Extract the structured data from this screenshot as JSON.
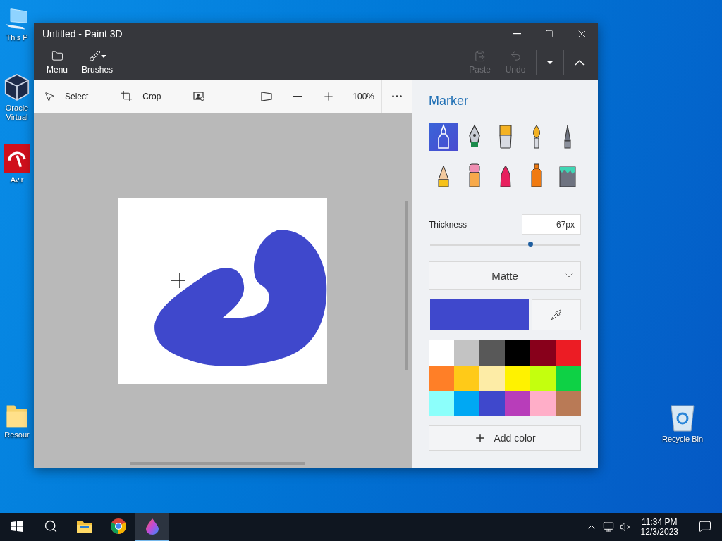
{
  "desktop_icons": [
    {
      "kind": "computer",
      "label": "This P"
    },
    {
      "kind": "cube",
      "label": "Oracle\nVirtual"
    },
    {
      "kind": "umbrella",
      "label": "Avir"
    },
    {
      "kind": "folder",
      "label": "Resour"
    },
    {
      "kind": "bin",
      "label": "Recycle Bin"
    }
  ],
  "window": {
    "title": "Untitled - Paint 3D",
    "commands": [
      {
        "kind": "menu",
        "label": "Menu"
      },
      {
        "kind": "brushes",
        "label": "Brushes"
      }
    ],
    "right_commands": [
      {
        "kind": "paste",
        "label": "Paste",
        "disabled": true
      },
      {
        "kind": "undo",
        "label": "Undo",
        "disabled": true
      }
    ],
    "toolbar": [
      {
        "kind": "select",
        "label": "Select"
      },
      {
        "kind": "crop",
        "label": "Crop"
      },
      {
        "kind": "magic"
      }
    ],
    "zoom": "100%",
    "panel": {
      "title": "Marker",
      "tools": [
        {
          "kind": "marker",
          "selected": true
        },
        {
          "kind": "pen",
          "selected": false
        },
        {
          "kind": "oil",
          "selected": false
        },
        {
          "kind": "watercolor",
          "selected": false
        },
        {
          "kind": "pixel",
          "selected": false
        },
        {
          "kind": "pencil",
          "selected": false
        },
        {
          "kind": "eraser",
          "selected": false
        },
        {
          "kind": "crayon",
          "selected": false
        },
        {
          "kind": "spray",
          "selected": false
        },
        {
          "kind": "fill",
          "selected": false
        }
      ],
      "thickness": {
        "label": "Thickness",
        "value": "67",
        "unit": "px",
        "level": 0.67
      },
      "finish": "Matte",
      "current_color": {
        "color": "#3f48cc"
      },
      "palette": [
        {
          "color": "#ffffff"
        },
        {
          "color": "#c3c3c3"
        },
        {
          "color": "#585858"
        },
        {
          "color": "#000000"
        },
        {
          "color": "#88001b"
        },
        {
          "color": "#ec1c24"
        },
        {
          "color": "#ff7f27"
        },
        {
          "color": "#ffca18"
        },
        {
          "color": "#fdeca6"
        },
        {
          "color": "#fff200"
        },
        {
          "color": "#c4ff0e"
        },
        {
          "color": "#0ed145"
        },
        {
          "color": "#8cfffb"
        },
        {
          "color": "#00a8f3"
        },
        {
          "color": "#3f48cc"
        },
        {
          "color": "#b83dba"
        },
        {
          "color": "#ffaec8"
        },
        {
          "color": "#b97a56"
        }
      ],
      "add_color": "Add color"
    }
  },
  "taskbar": {
    "apps": [
      {
        "kind": "explorer",
        "active": false
      },
      {
        "kind": "chrome",
        "active": false
      },
      {
        "kind": "paint3d",
        "active": true
      }
    ],
    "time": "11:34 PM",
    "date": "12/3/2023"
  }
}
